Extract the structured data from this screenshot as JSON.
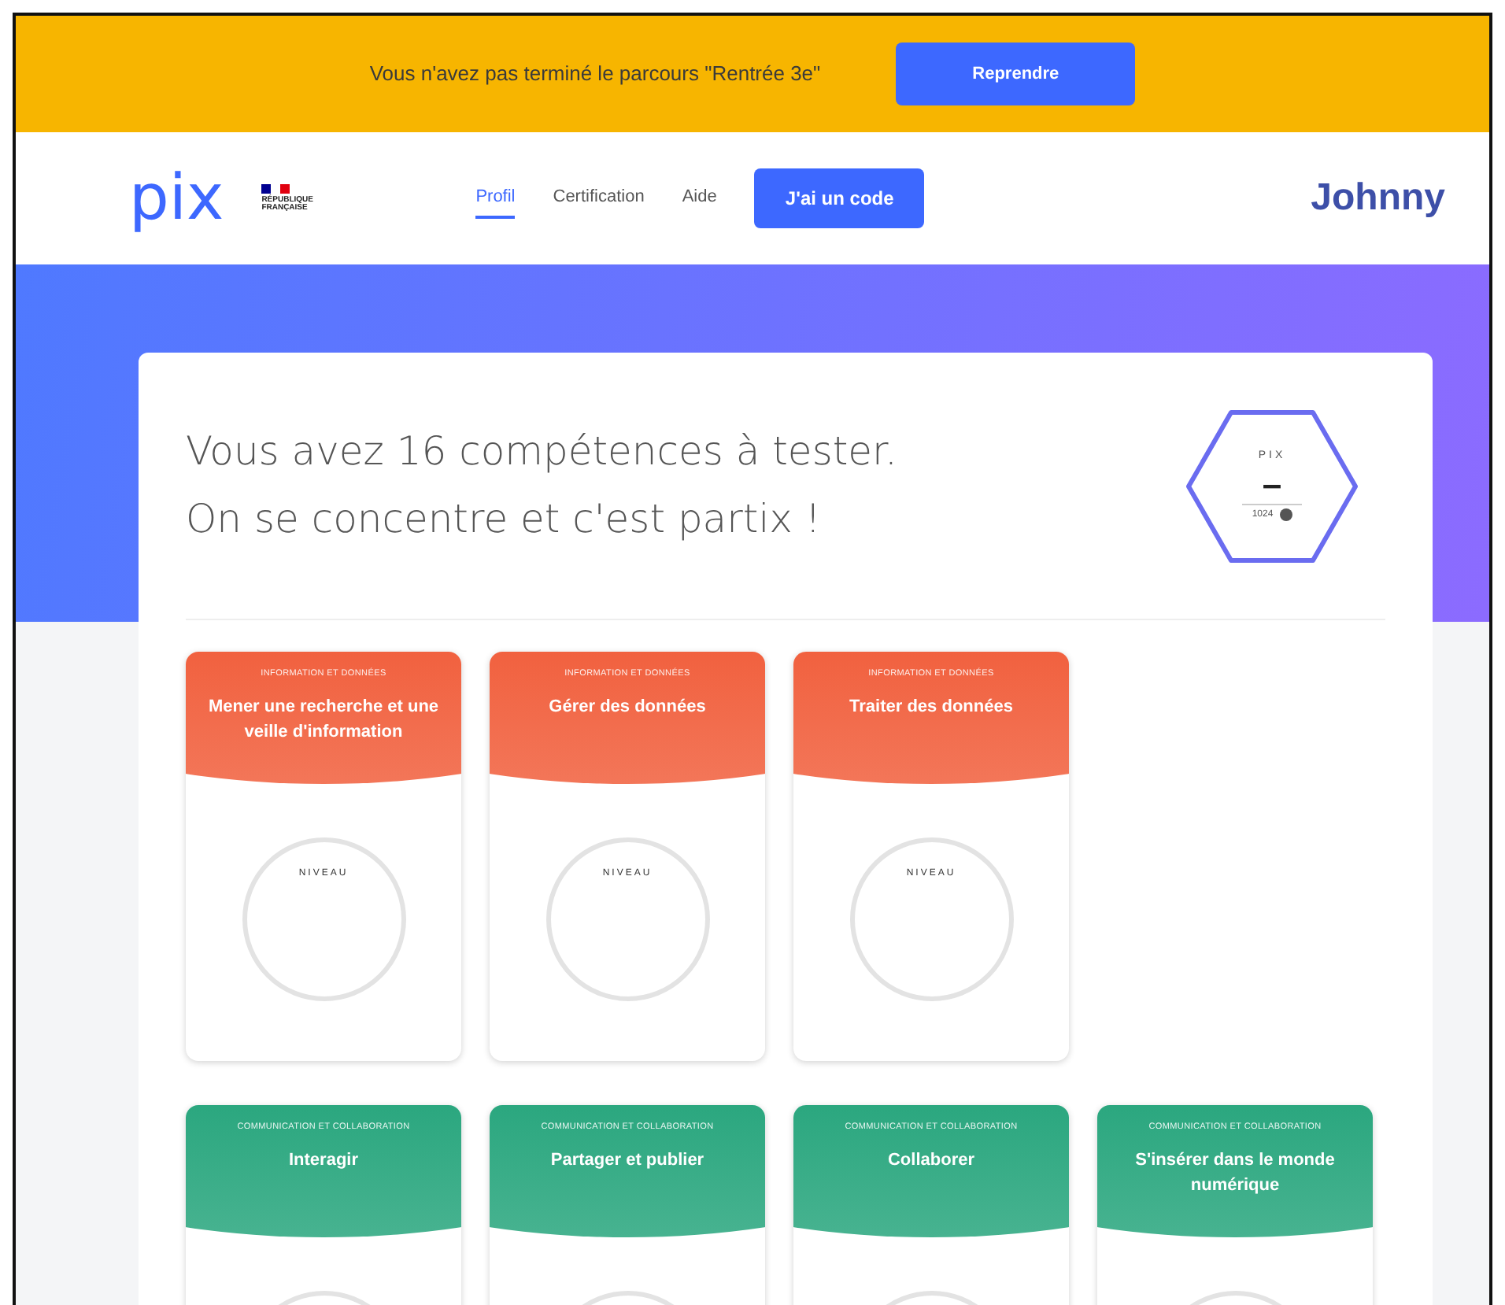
{
  "banner": {
    "message": "Vous n'avez pas terminé le parcours \"Rentrée 3e\"",
    "button": "Reprendre"
  },
  "header": {
    "logo": "pix",
    "republic_label": "RÉPUBLIQUE FRANÇAISE",
    "nav": [
      {
        "label": "Profil",
        "selected": true
      },
      {
        "label": "Certification",
        "selected": false
      },
      {
        "label": "Aide",
        "selected": false
      }
    ],
    "code_button": "J'ai un code",
    "user": "Johnny"
  },
  "intro": {
    "lines": [
      "Vous avez 16 compétences à tester.",
      "On se concentre et c'est partix !"
    ]
  },
  "score": {
    "label": "PIX",
    "value": "–",
    "max": "1024"
  },
  "competence_rows": [
    [
      {
        "area": "INFORMATION ET DONNÉES",
        "name": "Mener une recherche et une veille d'information",
        "color": "#f1613f",
        "level_label": "NIVEAU"
      },
      {
        "area": "INFORMATION ET DONNÉES",
        "name": "Gérer des données",
        "color": "#f1613f",
        "level_label": "NIVEAU"
      },
      {
        "area": "INFORMATION ET DONNÉES",
        "name": "Traiter des données",
        "color": "#f1613f",
        "level_label": "NIVEAU"
      }
    ],
    [
      {
        "area": "COMMUNICATION ET COLLABORATION",
        "name": "Interagir",
        "color": "#2ba77f"
      },
      {
        "area": "COMMUNICATION ET COLLABORATION",
        "name": "Partager et publier",
        "color": "#2ba77f"
      },
      {
        "area": "COMMUNICATION ET COLLABORATION",
        "name": "Collaborer",
        "color": "#2ba77f"
      },
      {
        "area": "COMMUNICATION ET COLLABORATION",
        "name": "S'insérer dans le monde numérique",
        "color": "#2ba77f"
      }
    ]
  ]
}
